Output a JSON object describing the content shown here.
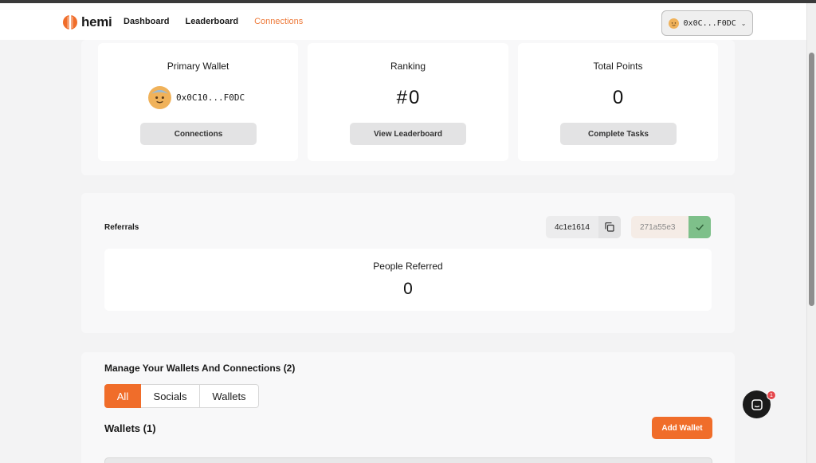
{
  "header": {
    "brand": "hemi",
    "nav": [
      {
        "label": "Dashboard",
        "active": false
      },
      {
        "label": "Leaderboard",
        "active": false
      },
      {
        "label": "Connections",
        "active": true
      }
    ],
    "wallet_button": {
      "address": "0x0C...F0DC",
      "chevron": "chevron-down-icon"
    }
  },
  "stats": {
    "primary_wallet": {
      "title": "Primary Wallet",
      "address": "0x0C10...F0DC",
      "button": "Connections"
    },
    "ranking": {
      "title": "Ranking",
      "prefix": "#",
      "value": "0",
      "button": "View Leaderboard"
    },
    "total_points": {
      "title": "Total Points",
      "value": "0",
      "button": "Complete Tasks"
    }
  },
  "referrals": {
    "label": "Referrals",
    "my_code": "4c1e1614",
    "entered_code": "271a55e3",
    "people_referred": {
      "title": "People Referred",
      "value": "0"
    }
  },
  "manage": {
    "title": "Manage Your Wallets And Connections (2)",
    "tabs": [
      {
        "label": "All",
        "active": true
      },
      {
        "label": "Socials",
        "active": false
      },
      {
        "label": "Wallets",
        "active": false
      }
    ],
    "wallets_heading": "Wallets (1)",
    "add_wallet": "Add Wallet"
  },
  "chat": {
    "badge": "1"
  },
  "colors": {
    "accent": "#f06d2a",
    "nav_active": "#ee7a3a",
    "success": "#7ec08a",
    "badge": "#e5484d"
  }
}
